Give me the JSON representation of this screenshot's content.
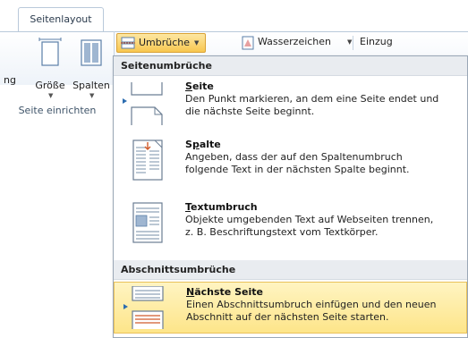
{
  "ribbon": {
    "tab_label": "Seitenlayout",
    "cut_label": "ng",
    "groesse_label": "Größe",
    "spalten_label": "Spalten",
    "group_label": "Seite einrichten",
    "umbrueche_label": "Umbrüche",
    "wasserzeichen_label": "Wasserzeichen",
    "einzug_label": "Einzug"
  },
  "menu": {
    "section1_title": "Seitenumbrüche",
    "section2_title": "Abschnittsumbrüche",
    "items": [
      {
        "title": "Seite",
        "underline_char": "S",
        "title_rest": "eite",
        "desc_line1": "Den Punkt markieren, an dem eine Seite endet und",
        "desc_line2": "die nächste Seite beginnt.",
        "icon": "page-break-icon"
      },
      {
        "title": "Spalte",
        "underline_char": "p",
        "title_rest": "alte",
        "desc_line1": "Angeben, dass der auf den Spaltenumbruch",
        "desc_line2": "folgende Text in der nächsten Spalte beginnt.",
        "icon": "column-break-icon"
      },
      {
        "title": "Textumbruch",
        "underline_char": "T",
        "title_rest": "extumbruch",
        "desc_line1": "Objekte umgebenden Text auf Webseiten trennen,",
        "desc_line2": "z. B. Beschriftungstext vom Textkörper.",
        "icon": "text-wrap-icon"
      },
      {
        "title": "Nächste Seite",
        "underline_char": "N",
        "title_rest": "ächste Seite",
        "desc_line1": "Einen Abschnittsumbruch einfügen und den neuen",
        "desc_line2": "Abschnitt auf der nächsten Seite starten.",
        "icon": "next-page-section-icon",
        "highlighted": true
      }
    ]
  },
  "colors": {
    "highlight": "#fde58a",
    "section_header_bg": "#e9ecf0",
    "umbrueche_button": "#f8c750"
  }
}
